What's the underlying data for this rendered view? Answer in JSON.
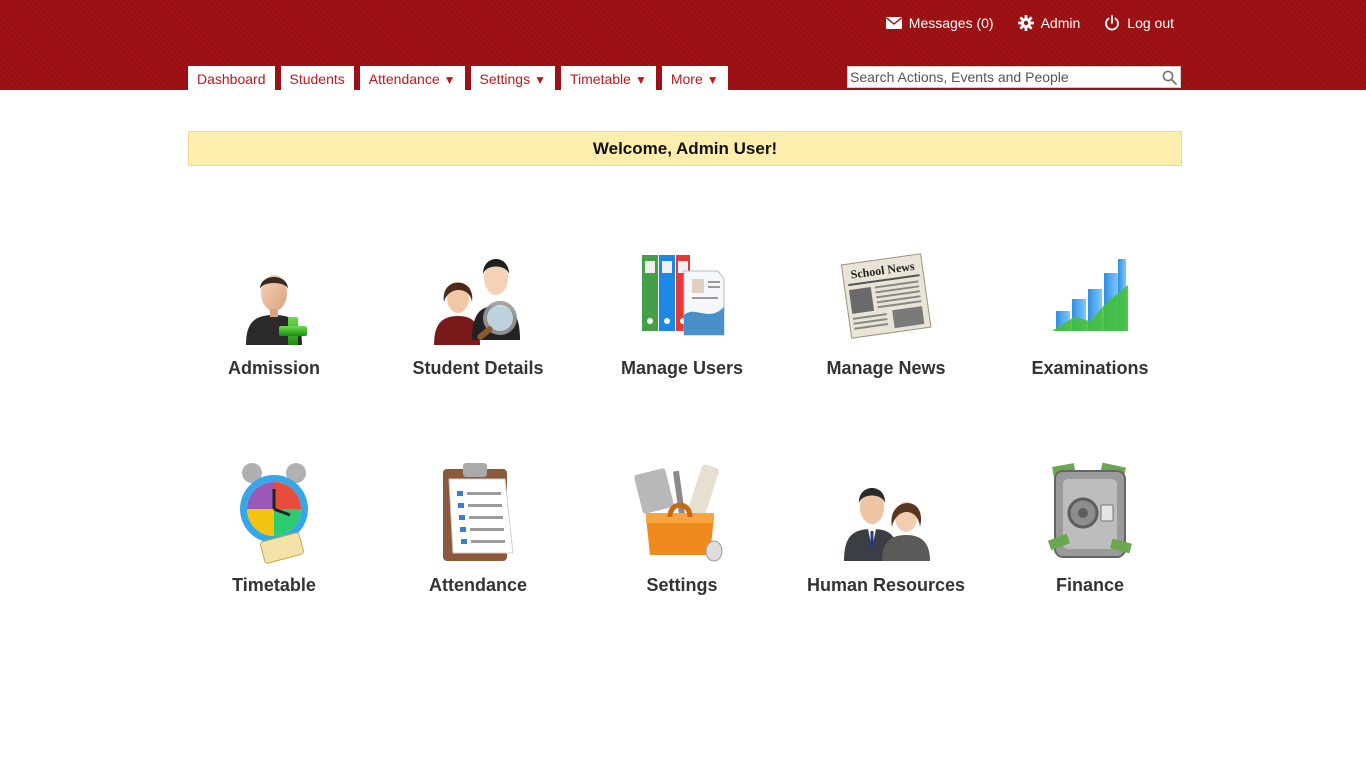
{
  "header": {
    "messages_label": "Messages (0)",
    "admin_label": "Admin",
    "logout_label": "Log out",
    "brand_color": "#9b0f12"
  },
  "nav": {
    "tabs": [
      {
        "label": "Dashboard",
        "caret": ""
      },
      {
        "label": "Students",
        "caret": ""
      },
      {
        "label": "Attendance",
        "caret": "▼"
      },
      {
        "label": "Settings",
        "caret": "▼"
      },
      {
        "label": "Timetable",
        "caret": "▼"
      },
      {
        "label": "More",
        "caret": "▼"
      }
    ]
  },
  "search": {
    "placeholder": "Search Actions, Events and People",
    "value": "",
    "icon": "search-icon"
  },
  "welcome": {
    "text": "Welcome, Admin User!"
  },
  "tiles": [
    {
      "label": "Admission",
      "icon": "admission-icon"
    },
    {
      "label": "Student Details",
      "icon": "student-details-icon"
    },
    {
      "label": "Manage Users",
      "icon": "manage-users-icon"
    },
    {
      "label": "Manage News",
      "icon": "manage-news-icon"
    },
    {
      "label": "Examinations",
      "icon": "examinations-icon"
    },
    {
      "label": "Timetable",
      "icon": "timetable-icon"
    },
    {
      "label": "Attendance",
      "icon": "attendance-icon"
    },
    {
      "label": "Settings",
      "icon": "settings-icon"
    },
    {
      "label": "Human Resources",
      "icon": "human-resources-icon"
    },
    {
      "label": "Finance",
      "icon": "finance-icon"
    }
  ],
  "news_icon_text": "School News"
}
